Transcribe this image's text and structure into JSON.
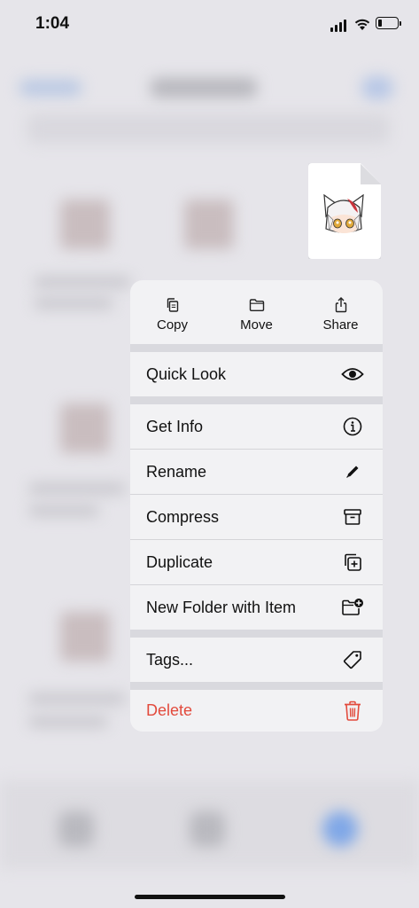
{
  "status_bar": {
    "time": "1:04",
    "battery_level": 0.2
  },
  "preview": {
    "icon": "anime-character-thumbnail"
  },
  "context_menu": {
    "top_actions": [
      {
        "label": "Copy",
        "icon": "copy-icon"
      },
      {
        "label": "Move",
        "icon": "folder-icon"
      },
      {
        "label": "Share",
        "icon": "share-icon"
      }
    ],
    "quick_look": {
      "label": "Quick Look",
      "icon": "eye-icon"
    },
    "items": [
      {
        "label": "Get Info",
        "icon": "info-icon"
      },
      {
        "label": "Rename",
        "icon": "pencil-icon"
      },
      {
        "label": "Compress",
        "icon": "archive-box-icon"
      },
      {
        "label": "Duplicate",
        "icon": "duplicate-icon"
      },
      {
        "label": "New Folder with Item",
        "icon": "folder-add-icon"
      }
    ],
    "tags": {
      "label": "Tags...",
      "icon": "tag-icon"
    },
    "delete": {
      "label": "Delete",
      "icon": "trash-icon",
      "color": "#e24a3c"
    }
  }
}
